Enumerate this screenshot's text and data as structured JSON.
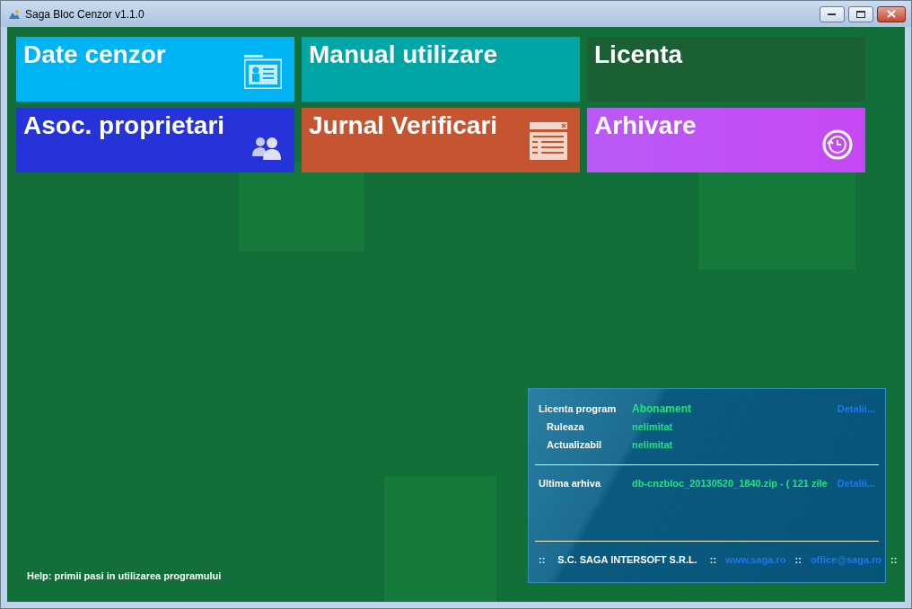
{
  "window": {
    "title": "Saga Bloc Cenzor v1.1.0"
  },
  "tiles": [
    {
      "label": "Date cenzor",
      "color": "#00b4f4",
      "kind": "card"
    },
    {
      "label": "Manual utilizare",
      "color": "#00a5a5",
      "kind": "plain"
    },
    {
      "label": "Licenta",
      "color": "#1b5f35",
      "kind": "plain"
    },
    {
      "label": "Asoc. proprietari",
      "color": "#2533d8",
      "kind": "people"
    },
    {
      "label": "Jurnal Verificari",
      "color": "#c55530",
      "kind": "list"
    },
    {
      "label": "Arhivare",
      "color": "#c648f4",
      "kind": "history"
    }
  ],
  "help": "Help: primii pasi in utilizarea programului",
  "info_panel": {
    "license": [
      {
        "label": "Licenta program",
        "value": "Abonament",
        "link": "Detalii..."
      },
      {
        "label": "Ruleaza",
        "value": "nelimitat"
      },
      {
        "label": "Actualizabil",
        "value": "nelimitat"
      }
    ],
    "archive": {
      "label": "Ultima arhiva",
      "value": "db-cnzbloc_20130520_1840.zip  - ( 121 zile",
      "link": "Detalii..."
    },
    "footer": [
      {
        "kind": "sep",
        "text": "::"
      },
      {
        "kind": "text",
        "text": "S.C. SAGA INTERSOFT S.R.L."
      },
      {
        "kind": "sep",
        "text": "::"
      },
      {
        "kind": "link",
        "text": "www.saga.ro"
      },
      {
        "kind": "sep",
        "text": "::"
      },
      {
        "kind": "link",
        "text": "office@saga.ro"
      },
      {
        "kind": "sep",
        "text": "::"
      }
    ]
  }
}
